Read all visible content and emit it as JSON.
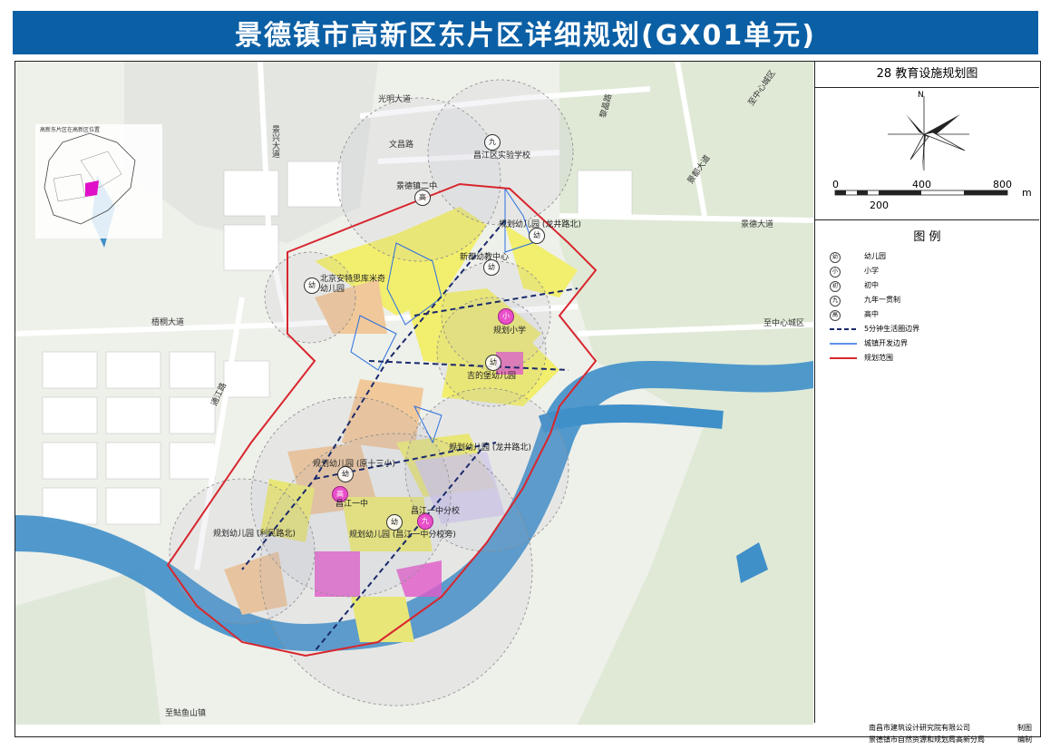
{
  "title": "景德镇市高新区东片区详细规划(GX01单元)",
  "panel": {
    "map_title": "28 教育设施规划图",
    "north_label": "N",
    "scale": {
      "t0": "0",
      "t400": "400",
      "t800": "800",
      "unit": "m",
      "t200": "200"
    }
  },
  "legend": {
    "title": "图 例",
    "items": [
      {
        "symbol": "幼",
        "label": "幼儿园"
      },
      {
        "symbol": "小",
        "label": "小学"
      },
      {
        "symbol": "初",
        "label": "初中"
      },
      {
        "symbol": "九",
        "label": "九年一贯制"
      },
      {
        "symbol": "高",
        "label": "高中"
      },
      {
        "label": "5分钟生活圈边界",
        "color": "#1a2a6c"
      },
      {
        "label": "城镇开发边界",
        "color": "#2a6fe0"
      },
      {
        "label": "规划范围",
        "color": "#d8262e"
      }
    ]
  },
  "footer": {
    "org1": "南昌市建筑设计研究院有限公司",
    "role1": "制图",
    "org2": "景德镇市自然资源和规划局高新分局",
    "role2": "编制"
  },
  "inset_title": "高新东片区在高新区位置",
  "roads": {
    "guangming": "光明大道",
    "wenchang": "文昌路",
    "jingxing": "景兴大道",
    "zhizhongxin1": "至中心城区",
    "jingdu": "景都大道",
    "jingde": "景德大道",
    "zhizhongxin2": "至中心城区",
    "wutong": "梧桐大道",
    "tongjiang": "通江路",
    "zhi_yushan": "至鲇鱼山镇",
    "lijing": "黎晶路"
  },
  "facilities": [
    {
      "name": "昌江区实验学校",
      "symbol": "九"
    },
    {
      "name": "景德镇二中",
      "symbol": "高"
    },
    {
      "name": "规划幼儿园 (龙井路北)",
      "symbol": "幼"
    },
    {
      "name": "新都幼教中心",
      "symbol": "幼"
    },
    {
      "name": "北京安特思库米奇幼儿园",
      "symbol": "幼"
    },
    {
      "name": "规划小学",
      "symbol": "小"
    },
    {
      "name": "吉的堡幼儿园",
      "symbol": "幼"
    },
    {
      "name": "规划幼儿园 (龙井路北)",
      "symbol": "幼"
    },
    {
      "name": "规划幼儿园 (原十三小)",
      "symbol": "幼"
    },
    {
      "name": "昌江一中",
      "symbol": "高"
    },
    {
      "name": "昌江一中分校",
      "symbol": "九"
    },
    {
      "name": "规划幼儿园 (利民路北)",
      "symbol": "幼"
    },
    {
      "name": "规划幼儿园 (昌江一中分校旁)",
      "symbol": "幼"
    }
  ]
}
